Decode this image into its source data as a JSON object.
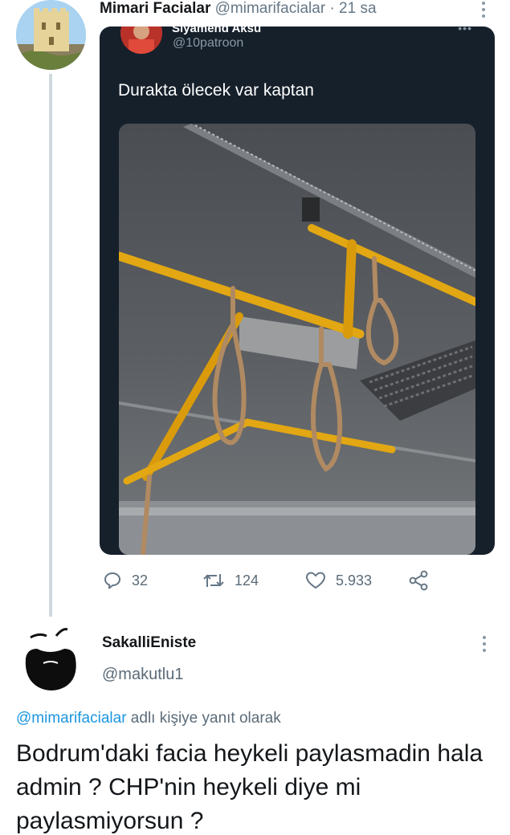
{
  "tweet": {
    "author_name": "Mimari Facialar",
    "author_handle": "@mimarifacialar",
    "separator": "·",
    "time": "21 sa",
    "quoted": {
      "name": "Siyamend Aksu",
      "handle": "@10patroon",
      "text": "Durakta ölecek var kaptan"
    },
    "stats": {
      "replies": "32",
      "retweets": "124",
      "likes": "5.933"
    }
  },
  "reply": {
    "author_name": "SakalliEniste",
    "author_handle": "@makutlu1",
    "reply_to_handle": "@mimarifacialar",
    "reply_to_suffix": " adlı kişiye yanıt olarak",
    "body": "Bodrum'daki facia heykeli paylasmadin hala admin ? CHP'nin heykeli diye mi paylasmiyorsun ?"
  },
  "colors": {
    "dark_card": "#15202b",
    "link": "#1b95e0",
    "secondary_text": "#657786",
    "thread_line": "#cfd9de"
  },
  "icons": [
    "reply-icon",
    "retweet-icon",
    "like-icon",
    "share-icon",
    "more-options-icon"
  ]
}
